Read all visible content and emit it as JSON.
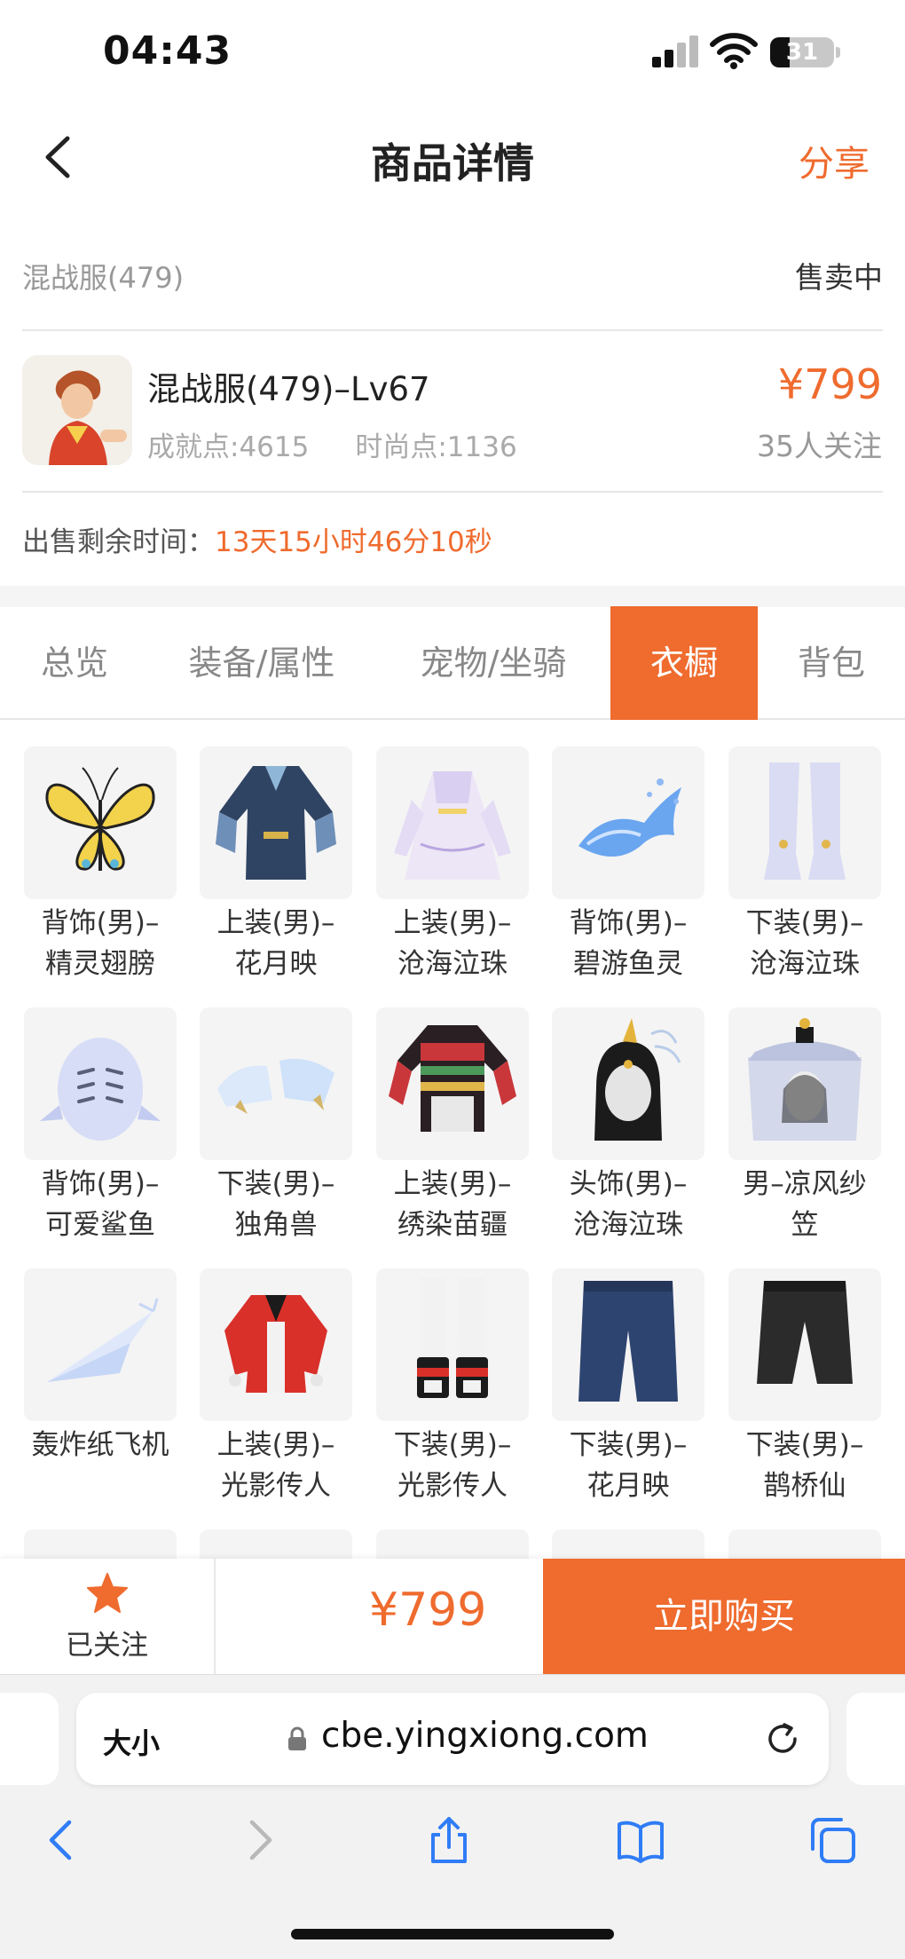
{
  "status_bar": {
    "time": "04:43",
    "battery": "31"
  },
  "nav": {
    "title": "商品详情",
    "share": "分享"
  },
  "server": {
    "name": "混战服(479)",
    "status": "售卖中"
  },
  "item": {
    "title": "混战服(479)–Lv67",
    "achievement": "成就点:4615",
    "fashion": "时尚点:1136",
    "price": "¥799",
    "followers": "35人关注"
  },
  "remaining": {
    "label": "出售剩余时间：",
    "value": "13天15小时46分10秒"
  },
  "tabs": [
    "总览",
    "装备/属性",
    "宠物/坐骑",
    "衣橱",
    "背包"
  ],
  "active_tab": "衣橱",
  "wardrobe": [
    {
      "line1": "背饰(男)–",
      "line2": "精灵翅膀",
      "icon": "butterfly-wings-icon"
    },
    {
      "line1": "上装(男)–",
      "line2": "花月映",
      "icon": "dark-robe-icon"
    },
    {
      "line1": "上装(男)–",
      "line2": "沧海泣珠",
      "icon": "white-dress-icon"
    },
    {
      "line1": "背饰(男)–",
      "line2": "碧游鱼灵",
      "icon": "water-fish-icon"
    },
    {
      "line1": "下装(男)–",
      "line2": "沧海泣珠",
      "icon": "white-boots-icon"
    },
    {
      "line1": "背饰(男)–",
      "line2": "可爱鲨鱼",
      "icon": "shark-icon"
    },
    {
      "line1": "下装(男)–",
      "line2": "独角兽",
      "icon": "unicorn-shoes-icon"
    },
    {
      "line1": "上装(男)–",
      "line2": "绣染苗疆",
      "icon": "embroidered-top-icon"
    },
    {
      "line1": "头饰(男)–",
      "line2": "沧海泣珠",
      "icon": "headdress-icon"
    },
    {
      "line1": "男–凉风纱",
      "line2": "笠",
      "icon": "veil-hat-icon"
    },
    {
      "line1": "轰炸纸飞机",
      "line2": "",
      "icon": "paper-plane-icon"
    },
    {
      "line1": "上装(男)–",
      "line2": "光影传人",
      "icon": "red-jacket-icon"
    },
    {
      "line1": "下装(男)–",
      "line2": "光影传人",
      "icon": "white-pants-icon"
    },
    {
      "line1": "下装(男)–",
      "line2": "花月映",
      "icon": "blue-pants-icon"
    },
    {
      "line1": "下装(男)–",
      "line2": "鹊桥仙",
      "icon": "black-pants-icon"
    }
  ],
  "action_bar": {
    "follow_label": "已关注",
    "price": "¥799",
    "buy_label": "立即购买"
  },
  "browser": {
    "text_size": "大小",
    "url": "cbe.yingxiong.com"
  },
  "colors": {
    "accent": "#ef6b2e",
    "background": "#ffffff"
  }
}
